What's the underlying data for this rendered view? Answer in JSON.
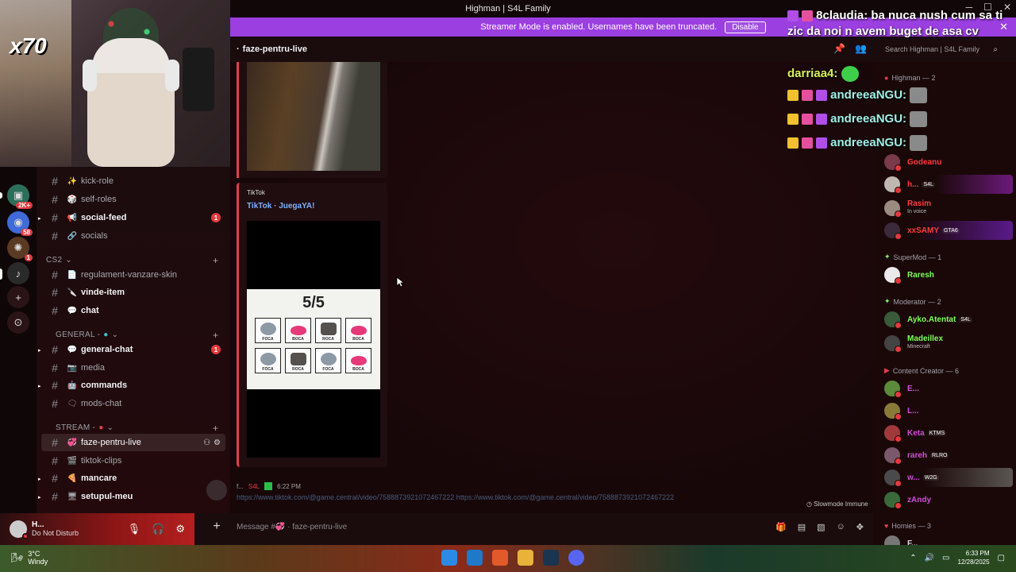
{
  "window": {
    "title": "Highman | S4L Family"
  },
  "streamer_bar": {
    "text": "Streamer Mode is enabled. Usernames have been truncated.",
    "button": "Disable"
  },
  "webcam": {
    "overlay": "x70"
  },
  "rail": {
    "badges": [
      "2K+",
      "58",
      "1"
    ]
  },
  "sidebar": {
    "items_top": [
      {
        "emoji": "✨",
        "label": "kick-role",
        "bold": false
      },
      {
        "emoji": "🎲",
        "label": "self-roles",
        "bold": false
      },
      {
        "emoji": "📢",
        "label": "social-feed",
        "bold": true,
        "mention": "1"
      },
      {
        "emoji": "🔗",
        "label": "socials",
        "bold": false
      }
    ],
    "cat_cs2": "CS2",
    "items_cs2": [
      {
        "emoji": "📄",
        "label": "regulament-vanzare-skin",
        "bold": false
      },
      {
        "emoji": "🔪",
        "label": "vinde-item",
        "bold": true
      },
      {
        "emoji": "💬",
        "label": "chat",
        "bold": true
      }
    ],
    "cat_general": "GENERAL -",
    "items_general": [
      {
        "emoji": "💬",
        "label": "general-chat",
        "bold": true,
        "mention": "1"
      },
      {
        "emoji": "📷",
        "label": "media",
        "bold": false
      },
      {
        "emoji": "🤖",
        "label": "commands",
        "bold": true
      },
      {
        "emoji": "🗨",
        "label": "mods-chat",
        "bold": false
      }
    ],
    "cat_stream": "STREAM -",
    "items_stream": [
      {
        "emoji": "💞",
        "label": "faze-pentru-live",
        "selected": true
      },
      {
        "emoji": "🎬",
        "label": "tiktok-clips",
        "bold": false
      },
      {
        "emoji": "🍕",
        "label": "mancare",
        "bold": true
      },
      {
        "emoji": "🖥",
        "label": "setupul-meu",
        "bold": true
      }
    ]
  },
  "user": {
    "name": "H...",
    "status": "Do Not Disturb"
  },
  "channel_header": {
    "name": "faze-pentru-live"
  },
  "embed": {
    "provider": "TikTok",
    "title": "TikTok · JuegaYA!",
    "game": {
      "score": "5/5",
      "tiles": [
        "FOCA",
        "BOCA",
        "ROCA",
        "BOCA",
        "FOCA",
        "ROCA",
        "FOCA",
        "BOCA"
      ]
    }
  },
  "message": {
    "author": "f...",
    "tag": "S4L",
    "time": "6:22 PM",
    "text": "https://www.tiktok.com/@game.central/video/7588873921072467222 https://www.tiktok.com/@game.central/video/7588873921072467222"
  },
  "slowmode": "Slowmode Immune",
  "composer": {
    "placeholder": "Message #💞 · faze-pentru-live"
  },
  "search": {
    "placeholder": "Search Highman | S4L Family"
  },
  "members": {
    "groups": [
      {
        "label": "Highman — 2"
      },
      {
        "label": "SuperMod — 1"
      },
      {
        "label": "Moderator — 2"
      },
      {
        "label": "Content Creator — 6"
      },
      {
        "label": "Homies — 3"
      }
    ],
    "list_a": [
      {
        "name": "Godeanu",
        "color": "#ff3b3b",
        "sub": "",
        "tag": ""
      },
      {
        "name": "h...",
        "color": "#ff3b3b",
        "sub": "",
        "tag": "S4L"
      },
      {
        "name": "Rasim",
        "color": "#ff3b3b",
        "sub": "In voice",
        "tag": ""
      },
      {
        "name": "xxSAMY",
        "color": "#ff3b3b",
        "sub": "",
        "tag": "GTA6"
      }
    ],
    "supermod": [
      {
        "name": "Raresh",
        "color": "#7dff5a"
      }
    ],
    "moderators": [
      {
        "name": "Ayko.Atentat",
        "color": "#7dff5a",
        "tag": "S4L"
      },
      {
        "name": "Madeillex",
        "color": "#7dff5a",
        "sub": "Minecraft"
      }
    ],
    "creators": [
      {
        "name": "E...",
        "color": "#d14dd8",
        "tag": ""
      },
      {
        "name": "L...",
        "color": "#d14dd8",
        "tag": ""
      },
      {
        "name": "Keta",
        "color": "#d14dd8",
        "tag": "KTMS"
      },
      {
        "name": "rareh",
        "color": "#d14dd8",
        "tag": "RLRO"
      },
      {
        "name": "w...",
        "color": "#d14dd8",
        "tag": "W2G"
      },
      {
        "name": "zAndy",
        "color": "#d14dd8",
        "tag": ""
      }
    ],
    "homies": [
      {
        "name": "F...",
        "color": "#dbdee1"
      }
    ]
  },
  "twitch_chat": {
    "line1_name": "8claudia:",
    "line1_text": "ba nuca nush cum sa ti zic da noi n avem buget de asa cv",
    "line2_name": "darriaa4:",
    "line3_name": "andreeaNGU:",
    "line4_name": "andreeaNGU:",
    "line5_name": "andreeaNGU:"
  },
  "taskbar": {
    "weather_temp": "3°C",
    "weather_desc": "Windy",
    "time": "6:33 PM",
    "date": "12/28/2025"
  }
}
